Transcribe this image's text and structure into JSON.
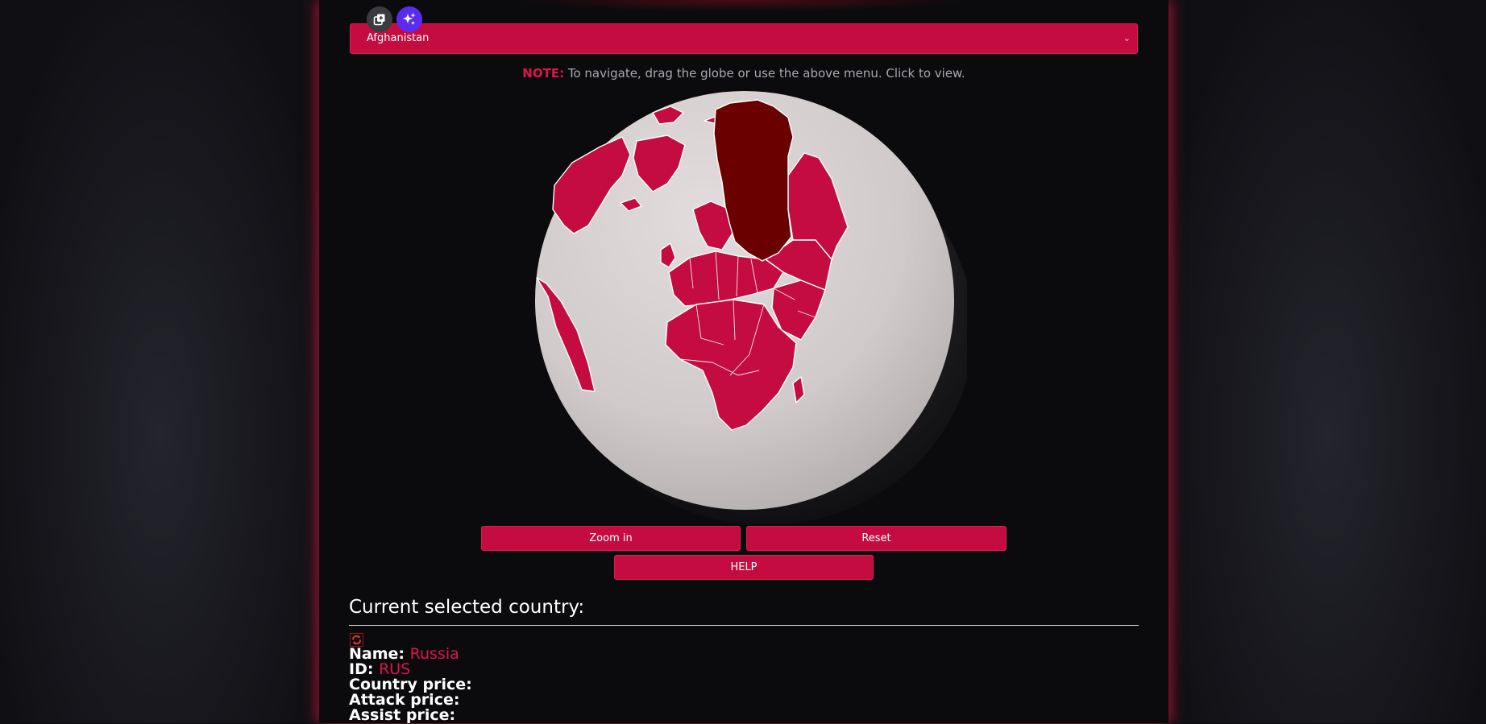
{
  "toolbar": {
    "copy_icon": "copy-icon",
    "ai_icon": "sparkles-icon"
  },
  "country_select": {
    "selected": "Afghanistan"
  },
  "note": {
    "label": "NOTE:",
    "text": " To navigate, drag the globe or use the above menu. Click to view."
  },
  "globe": {
    "highlighted_country": "Russia",
    "land_color": "#c40c40",
    "highlight_color": "#6b0000",
    "ocean_color": "#d6d0d0"
  },
  "buttons": {
    "zoom_in": "Zoom in",
    "reset": "Reset",
    "help": "HELP"
  },
  "selected": {
    "heading": "Current selected country:",
    "name_label": "Name:",
    "name_value": "Russia",
    "id_label": "ID:",
    "id_value": "RUS",
    "country_price_label": "Country price:",
    "attack_price_label": "Attack price:",
    "assist_price_label": "Assist price:"
  },
  "colors": {
    "accent": "#c40c40",
    "accent_text": "#e0144a",
    "panel": "#0b0b0d"
  }
}
